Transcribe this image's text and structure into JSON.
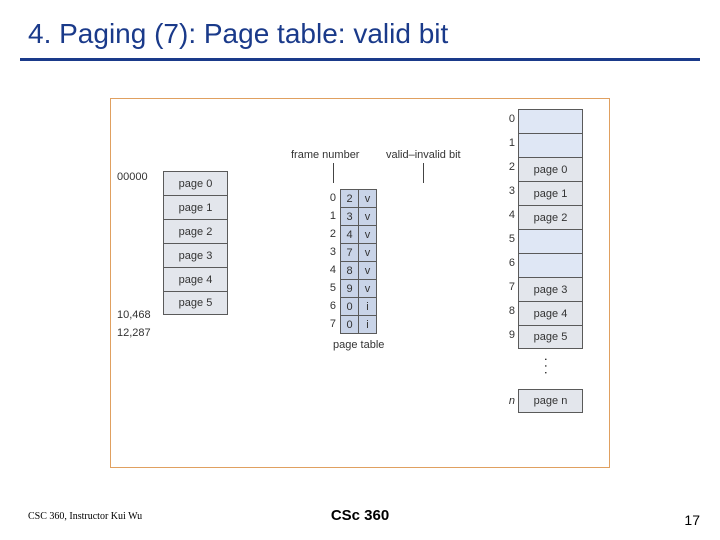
{
  "title": "4. Paging (7): Page table: valid bit",
  "logical_addr_start": "00000",
  "logical_addr_mid": "10,468",
  "logical_addr_end": "12,287",
  "logical_pages": [
    "page 0",
    "page 1",
    "page 2",
    "page 3",
    "page 4",
    "page 5"
  ],
  "pt_label_frame": "frame number",
  "pt_label_valid": "valid–invalid bit",
  "pt_caption": "page table",
  "page_table": {
    "index": [
      "0",
      "1",
      "2",
      "3",
      "4",
      "5",
      "6",
      "7"
    ],
    "frame": [
      "2",
      "3",
      "4",
      "7",
      "8",
      "9",
      "0",
      "0"
    ],
    "valid": [
      "v",
      "v",
      "v",
      "v",
      "v",
      "v",
      "i",
      "i"
    ]
  },
  "phys_frames": [
    {
      "idx": "0",
      "label": ""
    },
    {
      "idx": "1",
      "label": ""
    },
    {
      "idx": "2",
      "label": "page 0"
    },
    {
      "idx": "3",
      "label": "page 1"
    },
    {
      "idx": "4",
      "label": "page 2"
    },
    {
      "idx": "5",
      "label": ""
    },
    {
      "idx": "6",
      "label": ""
    },
    {
      "idx": "7",
      "label": "page 3"
    },
    {
      "idx": "8",
      "label": "page 4"
    },
    {
      "idx": "9",
      "label": "page 5"
    }
  ],
  "phys_n_idx": "n",
  "phys_n_label": "page n",
  "footer_left": "CSC 360, Instructor Kui Wu",
  "footer_center": "CSc 360",
  "footer_right": "17"
}
